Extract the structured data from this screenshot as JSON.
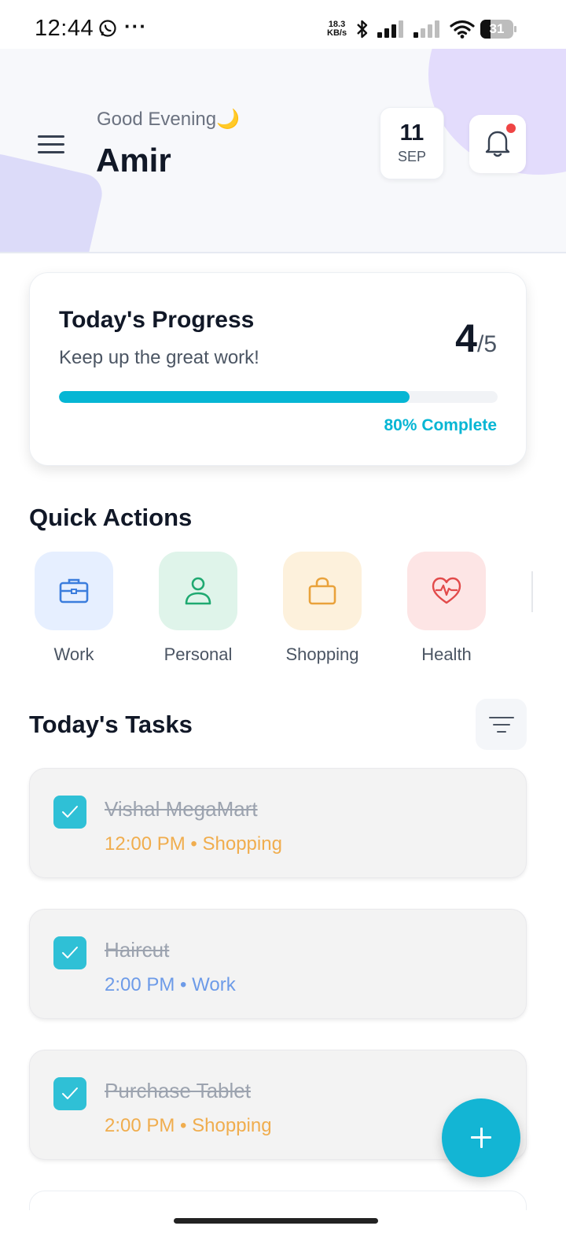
{
  "status_bar": {
    "time": "12:44",
    "more": "···",
    "net_speed_value": "18.3",
    "net_speed_unit": "KB/s",
    "battery": "31",
    "icons": [
      "whatsapp-icon",
      "bluetooth-icon",
      "signal-icon",
      "signal-icon",
      "wifi-icon",
      "battery-icon"
    ]
  },
  "header": {
    "greeting": "Good Evening🌙",
    "user_name": "Amir",
    "date_day": "11",
    "date_month": "SEP",
    "notification_unread": true
  },
  "progress": {
    "title": "Today's Progress",
    "subtitle": "Keep up the great work!",
    "completed": "4",
    "separator": "/",
    "total": "5",
    "fraction": 0.8,
    "percent_label": "80% Complete"
  },
  "quick_actions": {
    "title": "Quick Actions",
    "items": [
      {
        "label": "Work",
        "icon": "briefcase-icon",
        "bg": "#e6efff",
        "color": "#3b7ddd"
      },
      {
        "label": "Personal",
        "icon": "person-icon",
        "bg": "#dff4ea",
        "color": "#1fa971"
      },
      {
        "label": "Shopping",
        "icon": "shopping-bag-icon",
        "bg": "#fdf1dc",
        "color": "#e9a23b"
      },
      {
        "label": "Health",
        "icon": "heart-pulse-icon",
        "bg": "#fde5e5",
        "color": "#e24a4a"
      }
    ]
  },
  "tasks": {
    "title": "Today's Tasks",
    "items": [
      {
        "title": "Vishal MegaMart",
        "time": "12:00 PM",
        "bullet": " • ",
        "category": "Shopping",
        "completed": true
      },
      {
        "title": "Haircut",
        "time": "2:00 PM",
        "bullet": " • ",
        "category": "Work",
        "completed": true
      },
      {
        "title": "Purchase Tablet",
        "time": "2:00 PM",
        "bullet": " • ",
        "category": "Shopping",
        "completed": true
      }
    ]
  },
  "colors": {
    "accent": "#06b6d4",
    "fab": "#13b5d4",
    "check": "#2fc0d6",
    "shopping": "#f0ad4e",
    "work": "#6d9be8",
    "notification_dot": "#ef4444"
  }
}
